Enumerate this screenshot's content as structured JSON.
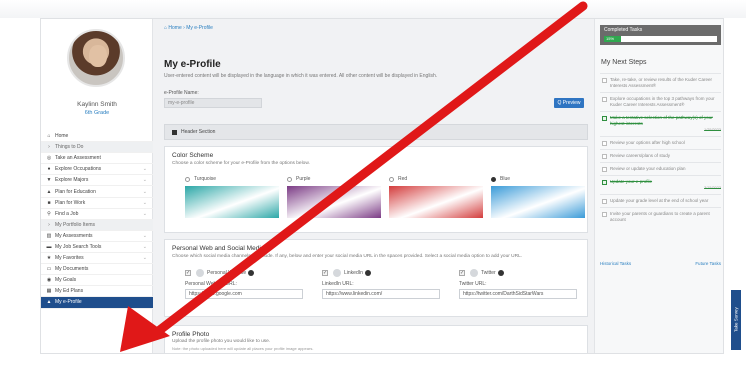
{
  "user": {
    "name": "Kaylinn Smith",
    "grade": "6th Grade"
  },
  "nav": [
    {
      "label": "Home",
      "icon": "home-icon",
      "glyph": "⌂",
      "type": "item"
    },
    {
      "label": "Things to Do",
      "icon": "chevron-icon",
      "glyph": "›",
      "type": "section"
    },
    {
      "label": "Take an Assessment",
      "icon": "assessment-icon",
      "glyph": "◎",
      "type": "item"
    },
    {
      "label": "Explore Occupations",
      "icon": "location-pin-icon",
      "glyph": "●",
      "type": "item",
      "chevron": true
    },
    {
      "label": "Explore Majors",
      "icon": "graduation-icon",
      "glyph": "▼",
      "type": "item",
      "chevron": true
    },
    {
      "label": "Plan for Education",
      "icon": "cap-icon",
      "glyph": "▲",
      "type": "item",
      "chevron": true
    },
    {
      "label": "Plan for Work",
      "icon": "building-icon",
      "glyph": "■",
      "type": "item",
      "chevron": true
    },
    {
      "label": "Find a Job",
      "icon": "search-icon",
      "glyph": "⚲",
      "type": "item",
      "chevron": true
    },
    {
      "label": "My Portfolio Items",
      "icon": "chevron-icon",
      "glyph": "›",
      "type": "section"
    },
    {
      "label": "My Assessments",
      "icon": "chart-icon",
      "glyph": "▥",
      "type": "item",
      "chevron": true
    },
    {
      "label": "My Job Search Tools",
      "icon": "briefcase-icon",
      "glyph": "▬",
      "type": "item",
      "chevron": true
    },
    {
      "label": "My Favorites",
      "icon": "star-icon",
      "glyph": "★",
      "type": "item",
      "chevron": true
    },
    {
      "label": "My Documents",
      "icon": "folder-icon",
      "glyph": "▭",
      "type": "item"
    },
    {
      "label": "My Goals",
      "icon": "target-icon",
      "glyph": "◉",
      "type": "item"
    },
    {
      "label": "My Ed Plans",
      "icon": "book-icon",
      "glyph": "▦",
      "type": "item"
    },
    {
      "label": "My e-Profile",
      "icon": "profile-icon",
      "glyph": "▲",
      "type": "active"
    }
  ],
  "breadcrumb": "⌂ Home › My e-Profile",
  "page": {
    "title": "My e-Profile",
    "subtitle": "User-entered content will be displayed in the language in which it was entered. All other content will be displayed in English.",
    "profile_name_label": "e-Profile Name:",
    "profile_name_value": "my-e-profile",
    "preview_label": "Q Preview",
    "header_section_label": "Header Section"
  },
  "color_scheme": {
    "title": "Color Scheme",
    "desc": "Choose a color scheme for your e-Profile from the options below.",
    "options": [
      {
        "label": "Turquoise",
        "selected": false,
        "color": "#2ba7a7"
      },
      {
        "label": "Purple",
        "selected": false,
        "color": "#7b3b85"
      },
      {
        "label": "Red",
        "selected": false,
        "color": "#d33c3c"
      },
      {
        "label": "Blue",
        "selected": true,
        "color": "#3a9bd8"
      }
    ]
  },
  "social": {
    "title": "Personal Web and Social Media",
    "desc": "Choose which social media channels to include. If any, below and enter your social media URL in the spaces provided. Select a social media option to add your URL.",
    "items": [
      {
        "name": "Personal Website",
        "url_label": "Personal Website URL:",
        "url": "https://www.google.com"
      },
      {
        "name": "LinkedIn",
        "url_label": "LinkedIn URL:",
        "url": "https://www.linkedin.com/"
      },
      {
        "name": "Twitter",
        "url_label": "Twitter URL:",
        "url": "https://twitter.com/DarthSidStarWars"
      }
    ]
  },
  "photo": {
    "title": "Profile Photo",
    "desc": "Upload the profile photo you would like to use.",
    "note": "Note: the photo uploaded here will update all places your profile image appears."
  },
  "completed_tasks": {
    "label": "Completed Tasks",
    "percent_label": "15%",
    "percent": 15
  },
  "next_steps": {
    "title": "My Next Steps",
    "items": [
      {
        "text": "Take, re-take, or review results of the Kuder Career Interests Assessment®",
        "done": false,
        "date": ""
      },
      {
        "text": "Explore occupations in the top 3 pathways from your Kuder Career Interests Assessment®",
        "done": false,
        "date": ""
      },
      {
        "text": "Make a tentative selection of the pathway(s) of your highest interests",
        "done": true,
        "date": "1/25/2023"
      },
      {
        "text": "Review your options after high school",
        "done": false,
        "date": ""
      },
      {
        "text": "Review careers/plans of study",
        "done": false,
        "date": ""
      },
      {
        "text": "Review or update your education plan",
        "done": false,
        "date": ""
      },
      {
        "text": "Update your e-profile",
        "done": true,
        "date": "3/15/2023"
      },
      {
        "text": "Update your grade level at the end of school year",
        "done": false,
        "date": ""
      },
      {
        "text": "Invite your parents or guardians to create a parent account",
        "done": false,
        "date": ""
      }
    ],
    "historical_link": "Historical Tasks",
    "future_link": "Future Tasks"
  },
  "survey_tab": "Take Survey",
  "colors": {
    "nav_active": "#1f4e8c",
    "accent": "#2f75c2",
    "arrow": "#e01818",
    "progress": "#2fa84f"
  }
}
